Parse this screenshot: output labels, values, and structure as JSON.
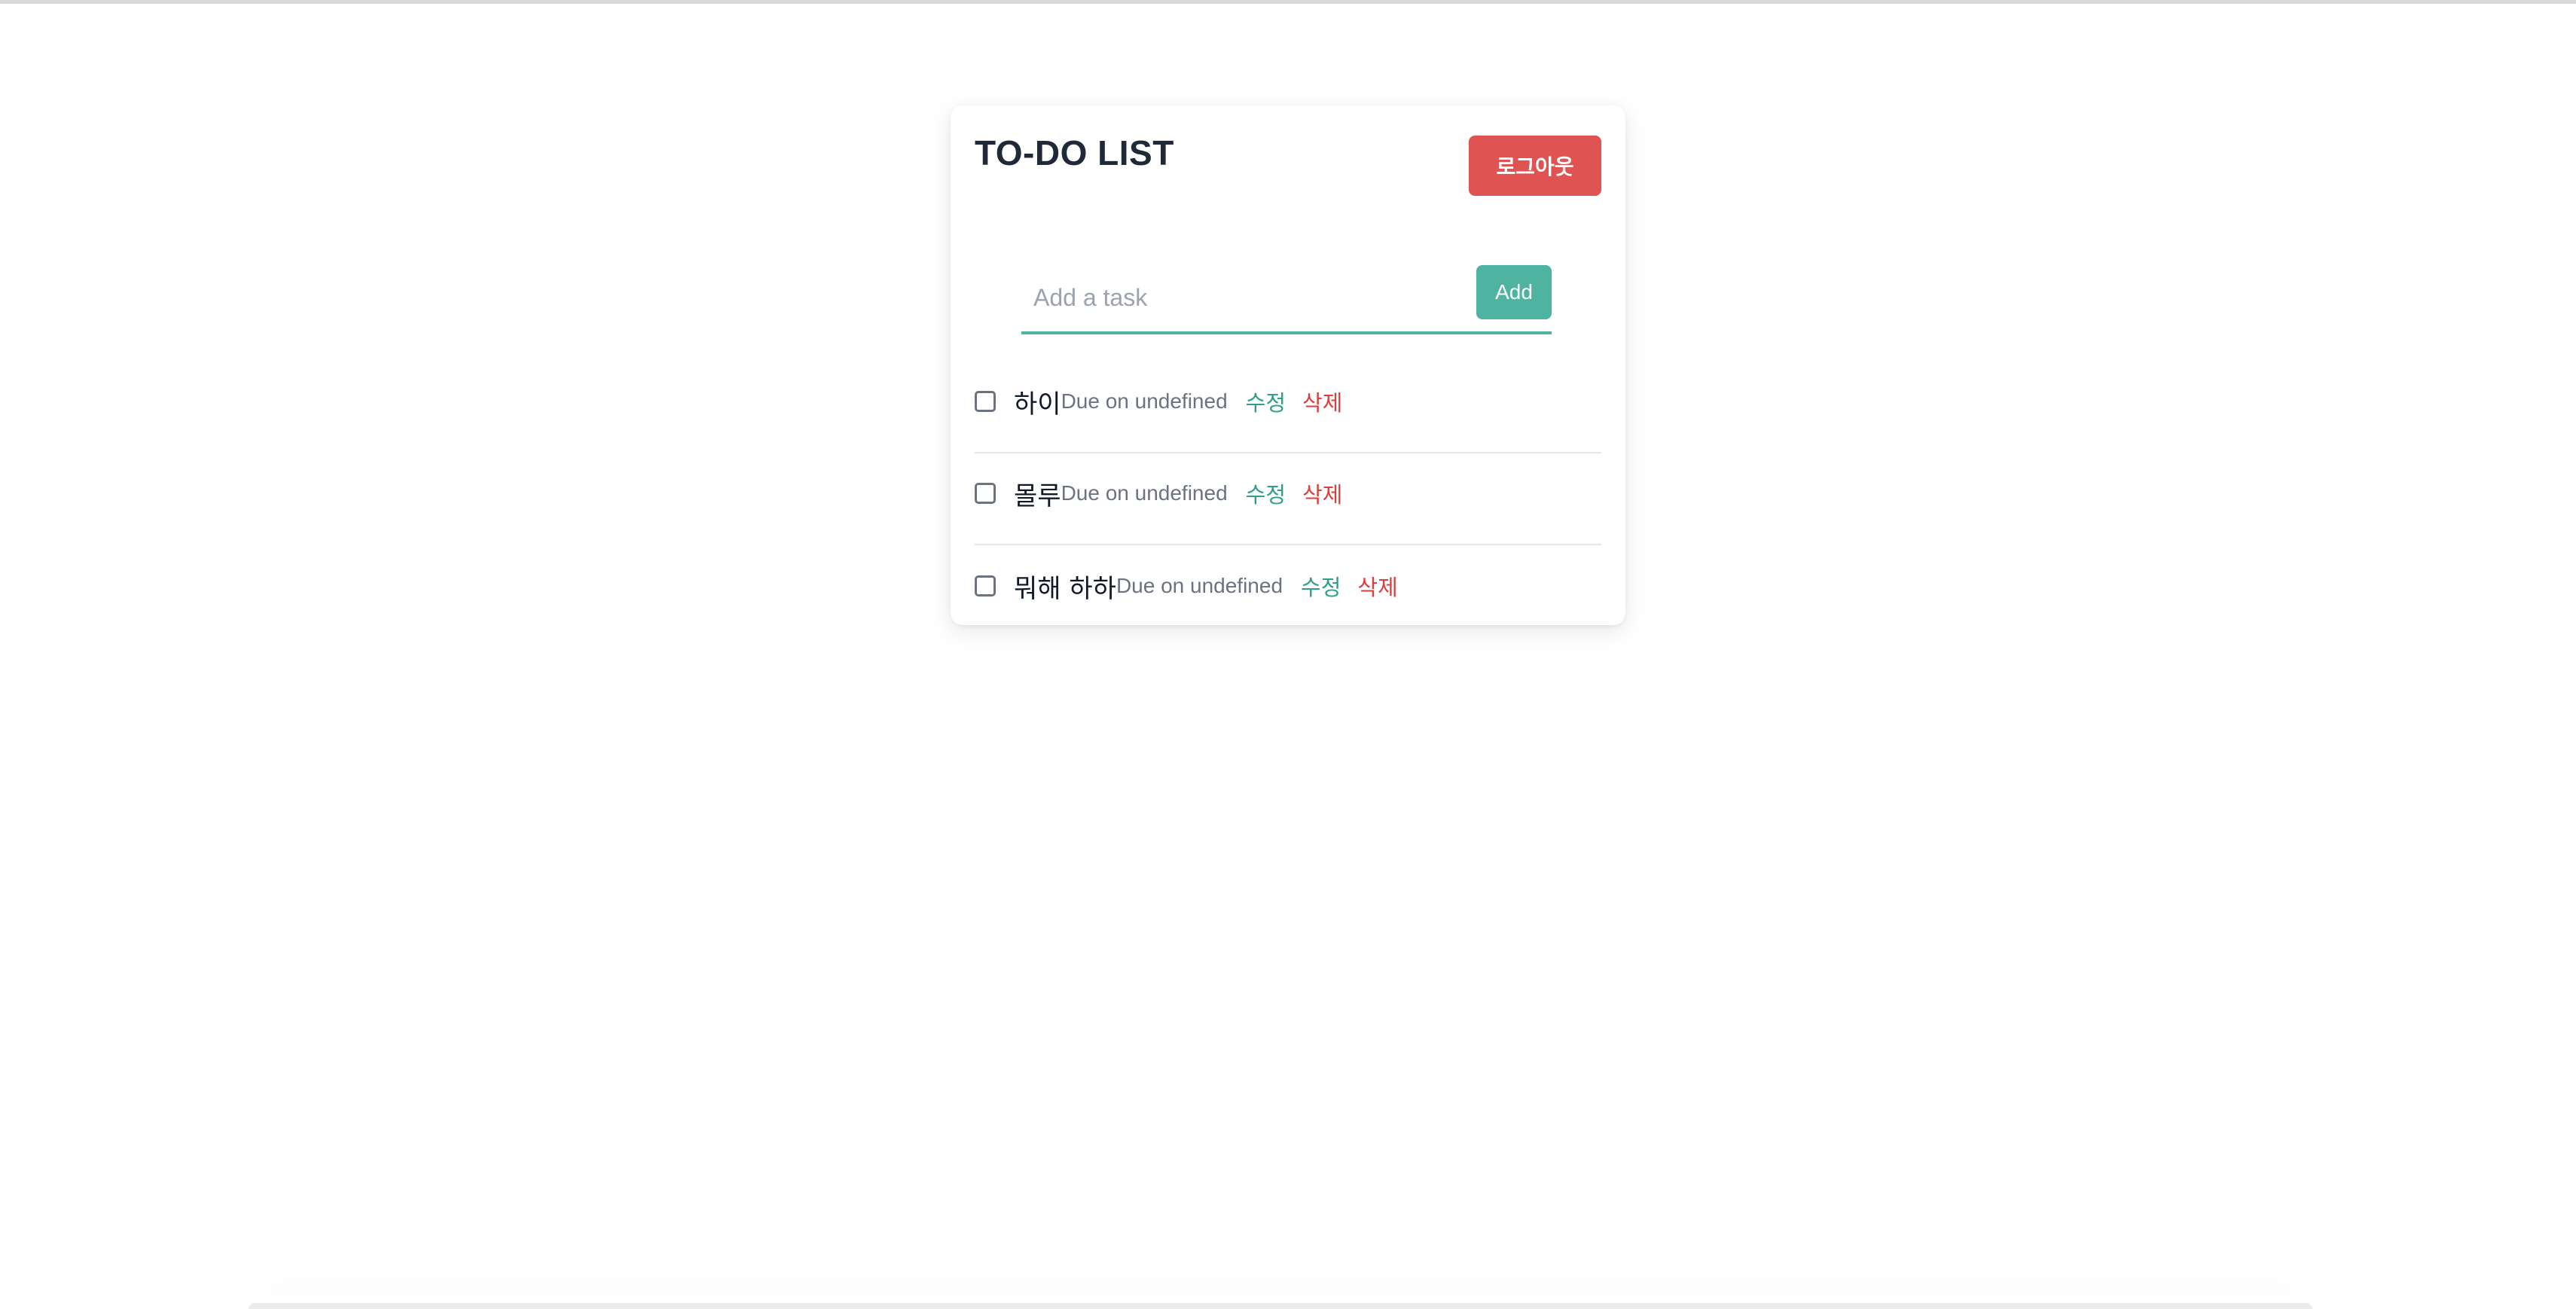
{
  "header": {
    "title": "TO-DO LIST",
    "logout_label": "로그아웃"
  },
  "add_form": {
    "placeholder": "Add a task",
    "value": "",
    "add_label": "Add"
  },
  "todos": [
    {
      "text": "하이",
      "due": "Due on undefined",
      "edit_label": "수정",
      "delete_label": "삭제",
      "checked": false
    },
    {
      "text": "몰루",
      "due": "Due on undefined",
      "edit_label": "수정",
      "delete_label": "삭제",
      "checked": false
    },
    {
      "text": "뭐해 하하",
      "due": "Due on undefined",
      "edit_label": "수정",
      "delete_label": "삭제",
      "checked": false
    }
  ],
  "colors": {
    "accent": "#4fb3a2",
    "danger": "#e05353",
    "edit_text": "#2f9e8a",
    "delete_text": "#dc3d3d"
  }
}
